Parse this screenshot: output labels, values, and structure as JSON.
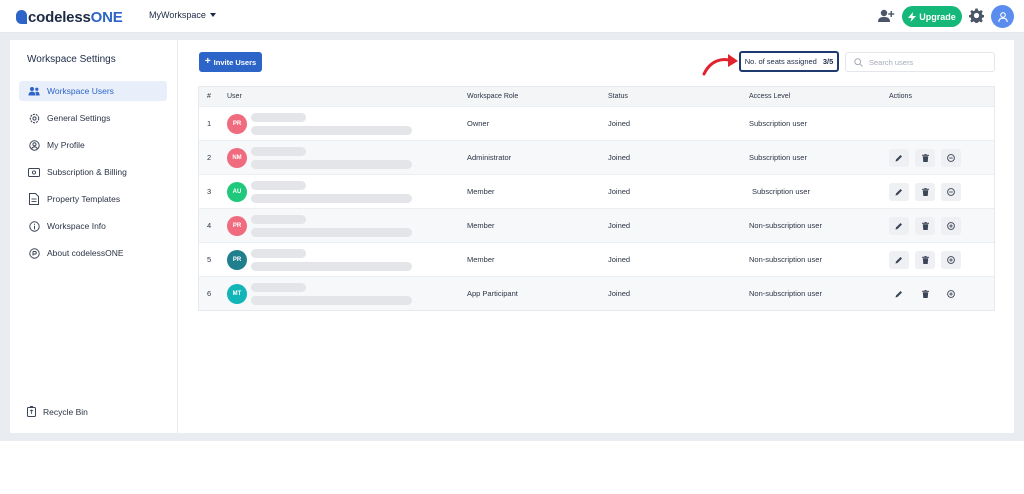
{
  "topbar": {
    "logo_prefix": "codeless",
    "logo_suffix": "ONE",
    "workspace": "MyWorkspace",
    "upgrade_label": "Upgrade",
    "brand_color": "#2d64c8",
    "upgrade_color": "#16b879"
  },
  "sidebar": {
    "title": "Workspace Settings",
    "items": [
      {
        "label": "Workspace Users",
        "icon": "users-icon",
        "active": true
      },
      {
        "label": "General Settings",
        "icon": "gear-icon"
      },
      {
        "label": "My Profile",
        "icon": "profile-icon"
      },
      {
        "label": "Subscription & Billing",
        "icon": "billing-icon"
      },
      {
        "label": "Property Templates",
        "icon": "template-icon"
      },
      {
        "label": "Workspace Info",
        "icon": "info-icon"
      },
      {
        "label": "About codelessONE",
        "icon": "about-icon"
      }
    ],
    "recycle_label": "Recycle Bin"
  },
  "main": {
    "invite_label": "Invite Users",
    "seats_label": "No. of seats assigned",
    "seats_value": "3/5",
    "search_placeholder": "Search users",
    "columns": [
      "#",
      "User",
      "Workspace Role",
      "Status",
      "Access Level",
      "Actions"
    ],
    "rows": [
      {
        "num": "1",
        "initials": "PR",
        "avatar_color": "#f06b7e",
        "role": "Owner",
        "status": "Joined",
        "access": "Subscription user",
        "actions": []
      },
      {
        "num": "2",
        "initials": "NM",
        "avatar_color": "#f06b7e",
        "role": "Administrator",
        "status": "Joined",
        "access": "Subscription user",
        "actions": [
          "edit-icon",
          "trash-icon",
          "minus-circle-icon"
        ]
      },
      {
        "num": "3",
        "initials": "AU",
        "avatar_color": "#1fc87a",
        "role": "Member",
        "status": "Joined",
        "access": "Subscription user",
        "actions": [
          "edit-icon",
          "trash-icon",
          "minus-circle-icon"
        ]
      },
      {
        "num": "4",
        "initials": "PR",
        "avatar_color": "#f06b7e",
        "role": "Member",
        "status": "Joined",
        "access": "Non-subscription user",
        "actions": [
          "edit-icon",
          "trash-icon",
          "plus-circle-icon"
        ]
      },
      {
        "num": "5",
        "initials": "PR",
        "avatar_color": "#1f7f8c",
        "role": "Member",
        "status": "Joined",
        "access": "Non-subscription user",
        "actions": [
          "edit-icon",
          "trash-icon",
          "plus-circle-icon"
        ]
      },
      {
        "num": "6",
        "initials": "MT",
        "avatar_color": "#11b5b7",
        "role": "App Participant",
        "status": "Joined",
        "access": "Non-subscription user",
        "actions": [
          "edit-icon",
          "trash-icon",
          "plus-circle-icon"
        ]
      }
    ]
  }
}
